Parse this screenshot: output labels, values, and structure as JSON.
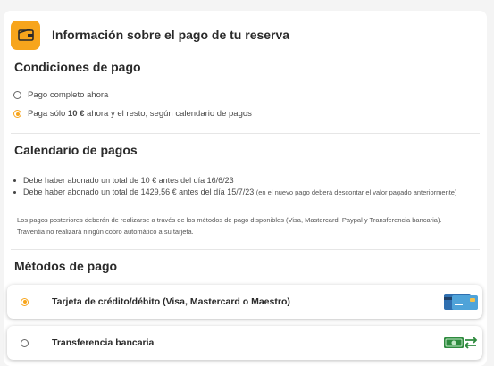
{
  "header": {
    "title": "Información sobre el pago de tu reserva",
    "icon": "wallet-icon"
  },
  "conditions": {
    "title": "Condiciones de pago",
    "options": [
      {
        "label": "Pago completo ahora",
        "selected": false
      },
      {
        "label_prefix": "Paga sólo ",
        "label_amount": "10 €",
        "label_suffix": " ahora y el resto, según calendario de pagos",
        "selected": true
      }
    ]
  },
  "schedule": {
    "title": "Calendario de pagos",
    "items": [
      {
        "text": "Debe haber abonado un total de 10 € antes del día 16/6/23"
      },
      {
        "text": "Debe haber abonado un total de 1429,56 € antes del día 15/7/23",
        "note": "(en el nuevo pago deberá descontar el valor pagado anteriormente)"
      }
    ],
    "disclaimer": "Los pagos posteriores deberán de realizarse a través de los métodos de pago disponibles (Visa, Mastercard, Paypal y Transferencia bancaria). Traventia no realizará ningún cobro automático a su tarjeta."
  },
  "methods": {
    "title": "Métodos de pago",
    "options": [
      {
        "label": "Tarjeta de crédito/débito (Visa, Mastercard o Maestro)",
        "selected": true,
        "icon": "credit-cards-icon"
      },
      {
        "label": "Transferencia bancaria",
        "selected": false,
        "icon": "bank-transfer-icon"
      }
    ]
  },
  "colors": {
    "accent": "#f7a51c",
    "background": "#f4f4f4",
    "card": "#ffffff"
  }
}
